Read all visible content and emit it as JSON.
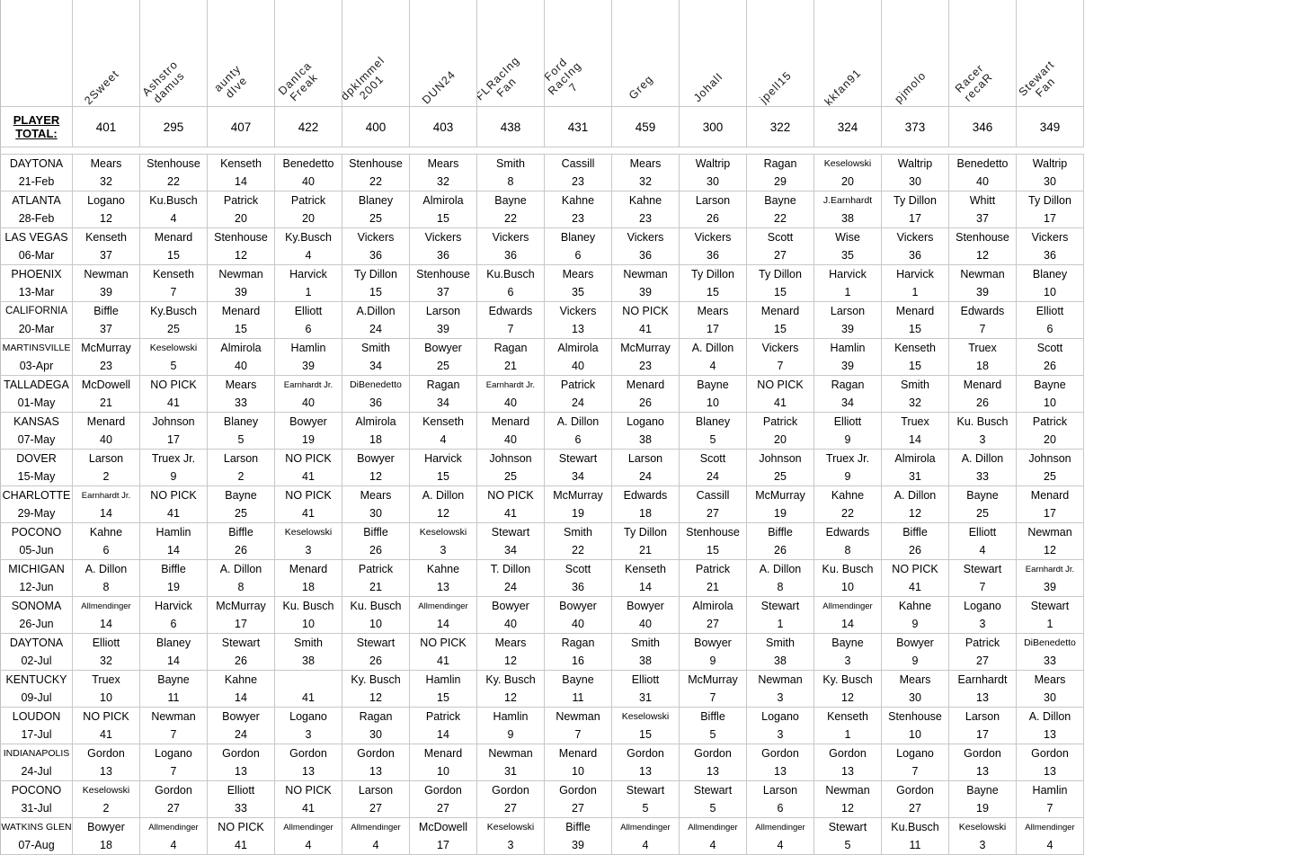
{
  "sheet": {
    "total_label_line1": "PLAYER",
    "total_label_line2": "TOTAL:"
  },
  "players": [
    "2Sweet",
    "Ashstro\ndamus",
    "aunty\ndIve",
    "DanIca\nFreak",
    "dpkImmel\n2001",
    "DUN24",
    "FLRacIng\nFan",
    "Ford\nRacIng\n7",
    "Greg",
    "JohalI",
    "jpell15",
    "kkfan91",
    "pjmolo",
    "Racer\nrecaR",
    "Stewart\nFan"
  ],
  "player_totals": [
    401,
    295,
    407,
    422,
    400,
    403,
    438,
    431,
    459,
    300,
    322,
    324,
    373,
    346,
    349
  ],
  "races": [
    {
      "track": "DAYTONA",
      "date": "21-Feb",
      "picks": [
        "Mears",
        "Stenhouse",
        "Kenseth",
        "Benedetto",
        "Stenhouse",
        "Mears",
        "Smith",
        "Cassill",
        "Mears",
        "Waltrip",
        "Ragan",
        "Keselowski",
        "Waltrip",
        "Benedetto",
        "Waltrip"
      ],
      "points": [
        32,
        22,
        14,
        40,
        22,
        32,
        8,
        23,
        32,
        30,
        29,
        20,
        30,
        40,
        30
      ]
    },
    {
      "track": "ATLANTA",
      "date": "28-Feb",
      "picks": [
        "Logano",
        "Ku.Busch",
        "Patrick",
        "Patrick",
        "Blaney",
        "Almirola",
        "Bayne",
        "Kahne",
        "Kahne",
        "Larson",
        "Bayne",
        "J.Earnhardt",
        "Ty Dillon",
        "Whitt",
        "Ty Dillon"
      ],
      "points": [
        12,
        4,
        20,
        20,
        25,
        15,
        22,
        23,
        23,
        26,
        22,
        38,
        17,
        37,
        17
      ]
    },
    {
      "track": "LAS VEGAS",
      "date": "06-Mar",
      "picks": [
        "Kenseth",
        "Menard",
        "Stenhouse",
        "Ky.Busch",
        "Vickers",
        "Vickers",
        "Vickers",
        "Blaney",
        "Vickers",
        "Vickers",
        "Scott",
        "Wise",
        "Vickers",
        "Stenhouse",
        "Vickers"
      ],
      "points": [
        37,
        15,
        12,
        4,
        36,
        36,
        36,
        6,
        36,
        36,
        27,
        35,
        36,
        12,
        36
      ]
    },
    {
      "track": "PHOENIX",
      "date": "13-Mar",
      "picks": [
        "Newman",
        "Kenseth",
        "Newman",
        "Harvick",
        "Ty Dillon",
        "Stenhouse",
        "Ku.Busch",
        "Mears",
        "Newman",
        "Ty Dillon",
        "Ty Dillon",
        "Harvick",
        "Harvick",
        "Newman",
        "Blaney"
      ],
      "points": [
        39,
        7,
        39,
        1,
        15,
        37,
        6,
        35,
        39,
        15,
        15,
        1,
        1,
        39,
        10
      ]
    },
    {
      "track": "CALIFORNIA",
      "date": "20-Mar",
      "picks": [
        "Biffle",
        "Ky.Busch",
        "Menard",
        "Elliott",
        "A.Dillon",
        "Larson",
        "Edwards",
        "Vickers",
        "NO PICK",
        "Mears",
        "Menard",
        "Larson",
        "Menard",
        "Edwards",
        "Elliott"
      ],
      "points": [
        37,
        25,
        15,
        6,
        24,
        39,
        7,
        13,
        41,
        17,
        15,
        39,
        15,
        7,
        6
      ]
    },
    {
      "track": "MARTINSVILLE",
      "date": "03-Apr",
      "picks": [
        "McMurray",
        "Keselowski",
        "Almirola",
        "Hamlin",
        "Smith",
        "Bowyer",
        "Ragan",
        "Almirola",
        "McMurray",
        "A. Dillon",
        "Vickers",
        "Hamlin",
        "Kenseth",
        "Truex",
        "Scott"
      ],
      "points": [
        23,
        5,
        40,
        39,
        34,
        25,
        21,
        40,
        23,
        4,
        7,
        39,
        15,
        18,
        26
      ]
    },
    {
      "track": "TALLADEGA",
      "date": "01-May",
      "picks": [
        "McDowell",
        "NO PICK",
        "Mears",
        "Earnhardt Jr.",
        "DiBenedetto",
        "Ragan",
        "Earnhardt Jr.",
        "Patrick",
        "Menard",
        "Bayne",
        "NO PICK",
        "Ragan",
        "Smith",
        "Menard",
        "Bayne"
      ],
      "points": [
        21,
        41,
        33,
        40,
        36,
        34,
        40,
        24,
        26,
        10,
        41,
        34,
        32,
        26,
        10
      ]
    },
    {
      "track": "KANSAS",
      "date": "07-May",
      "picks": [
        "Menard",
        "Johnson",
        "Blaney",
        "Bowyer",
        "Almirola",
        "Kenseth",
        "Menard",
        "A. Dillon",
        "Logano",
        "Blaney",
        "Patrick",
        "Elliott",
        "Truex",
        "Ku. Busch",
        "Patrick"
      ],
      "points": [
        40,
        17,
        5,
        19,
        18,
        4,
        40,
        6,
        38,
        5,
        20,
        9,
        14,
        3,
        20
      ]
    },
    {
      "track": "DOVER",
      "date": "15-May",
      "picks": [
        "Larson",
        "Truex Jr.",
        "Larson",
        "NO PICK",
        "Bowyer",
        "Harvick",
        "Johnson",
        "Stewart",
        "Larson",
        "Scott",
        "Johnson",
        "Truex Jr.",
        "Almirola",
        "A. Dillon",
        "Johnson"
      ],
      "points": [
        2,
        9,
        2,
        41,
        12,
        15,
        25,
        34,
        24,
        24,
        25,
        9,
        31,
        33,
        25
      ]
    },
    {
      "track": "CHARLOTTE",
      "date": "29-May",
      "picks": [
        "Earnhardt Jr.",
        "NO PICK",
        "Bayne",
        "NO PICK",
        "Mears",
        "A. Dillon",
        "NO PICK",
        "McMurray",
        "Edwards",
        "Cassill",
        "McMurray",
        "Kahne",
        "A. Dillon",
        "Bayne",
        "Menard"
      ],
      "points": [
        14,
        41,
        25,
        41,
        30,
        12,
        41,
        19,
        18,
        27,
        19,
        22,
        12,
        25,
        17
      ]
    },
    {
      "track": "POCONO",
      "date": "05-Jun",
      "picks": [
        "Kahne",
        "Hamlin",
        "Biffle",
        "Keselowski",
        "Biffle",
        "Keselowski",
        "Stewart",
        "Smith",
        "Ty Dillon",
        "Stenhouse",
        "Biffle",
        "Edwards",
        "Biffle",
        "Elliott",
        "Newman"
      ],
      "points": [
        6,
        14,
        26,
        3,
        26,
        3,
        34,
        22,
        21,
        15,
        26,
        8,
        26,
        4,
        12
      ]
    },
    {
      "track": "MICHIGAN",
      "date": "12-Jun",
      "picks": [
        "A. Dillon",
        "Biffle",
        "A. Dillon",
        "Menard",
        "Patrick",
        "Kahne",
        "T. Dillon",
        "Scott",
        "Kenseth",
        "Patrick",
        "A. Dillon",
        "Ku. Busch",
        "NO PICK",
        "Stewart",
        "Earnhardt Jr."
      ],
      "points": [
        8,
        19,
        8,
        18,
        21,
        13,
        24,
        36,
        14,
        21,
        8,
        10,
        41,
        7,
        39
      ]
    },
    {
      "track": "SONOMA",
      "date": "26-Jun",
      "picks": [
        "Allmendinger",
        "Harvick",
        "McMurray",
        "Ku. Busch",
        "Ku. Busch",
        "Allmendinger",
        "Bowyer",
        "Bowyer",
        "Bowyer",
        "Almirola",
        "Stewart",
        "Allmendinger",
        "Kahne",
        "Logano",
        "Stewart"
      ],
      "points": [
        14,
        6,
        17,
        10,
        10,
        14,
        40,
        40,
        40,
        27,
        1,
        14,
        9,
        3,
        1
      ]
    },
    {
      "track": "DAYTONA",
      "date": "02-Jul",
      "picks": [
        "Elliott",
        "Blaney",
        "Stewart",
        "Smith",
        "Stewart",
        "NO PICK",
        "Mears",
        "Ragan",
        "Smith",
        "Bowyer",
        "Smith",
        "Bayne",
        "Bowyer",
        "Patrick",
        "DiBenedetto"
      ],
      "points": [
        32,
        14,
        26,
        38,
        26,
        41,
        12,
        16,
        38,
        9,
        38,
        3,
        9,
        27,
        33
      ]
    },
    {
      "track": "KENTUCKY",
      "date": "09-Jul",
      "picks": [
        "Truex",
        "Bayne",
        "Kahne",
        "",
        "Ky. Busch",
        "Hamlin",
        "Ky. Busch",
        "Bayne",
        "Elliott",
        "McMurray",
        "Newman",
        "Ky. Busch",
        "Mears",
        "Earnhardt",
        "Mears"
      ],
      "points": [
        10,
        11,
        14,
        41,
        12,
        15,
        12,
        11,
        31,
        7,
        3,
        12,
        30,
        13,
        30
      ]
    },
    {
      "track": "LOUDON",
      "date": "17-Jul",
      "picks": [
        "NO PICK",
        "Newman",
        "Bowyer",
        "Logano",
        "Ragan",
        "Patrick",
        "Hamlin",
        "Newman",
        "Keselowski",
        "Biffle",
        "Logano",
        "Kenseth",
        "Stenhouse",
        "Larson",
        "A. Dillon"
      ],
      "points": [
        41,
        7,
        24,
        3,
        30,
        14,
        9,
        7,
        15,
        5,
        3,
        1,
        10,
        17,
        13
      ]
    },
    {
      "track": "INDIANAPOLIS",
      "date": "24-Jul",
      "picks": [
        "Gordon",
        "Logano",
        "Gordon",
        "Gordon",
        "Gordon",
        "Menard",
        "Newman",
        "Menard",
        "Gordon",
        "Gordon",
        "Gordon",
        "Gordon",
        "Logano",
        "Gordon",
        "Gordon"
      ],
      "points": [
        13,
        7,
        13,
        13,
        13,
        10,
        31,
        10,
        13,
        13,
        13,
        13,
        7,
        13,
        13
      ]
    },
    {
      "track": "POCONO",
      "date": "31-Jul",
      "picks": [
        "Keselowski",
        "Gordon",
        "Elliott",
        "NO PICK",
        "Larson",
        "Gordon",
        "Gordon",
        "Gordon",
        "Stewart",
        "Stewart",
        "Larson",
        "Newman",
        "Gordon",
        "Bayne",
        "Hamlin"
      ],
      "points": [
        2,
        27,
        33,
        41,
        27,
        27,
        27,
        27,
        5,
        5,
        6,
        12,
        27,
        19,
        7
      ]
    },
    {
      "track": "WATKINS GLEN",
      "date": "07-Aug",
      "picks": [
        "Bowyer",
        "Allmendinger",
        "NO PICK",
        "Allmendinger",
        "Allmendinger",
        "McDowell",
        "Keselowski",
        "Biffle",
        "Allmendinger",
        "Allmendinger",
        "Allmendinger",
        "Stewart",
        "Ku.Busch",
        "Keselowski",
        "Allmendinger"
      ],
      "points": [
        18,
        4,
        41,
        4,
        4,
        17,
        3,
        39,
        4,
        4,
        4,
        5,
        11,
        3,
        4
      ]
    }
  ]
}
